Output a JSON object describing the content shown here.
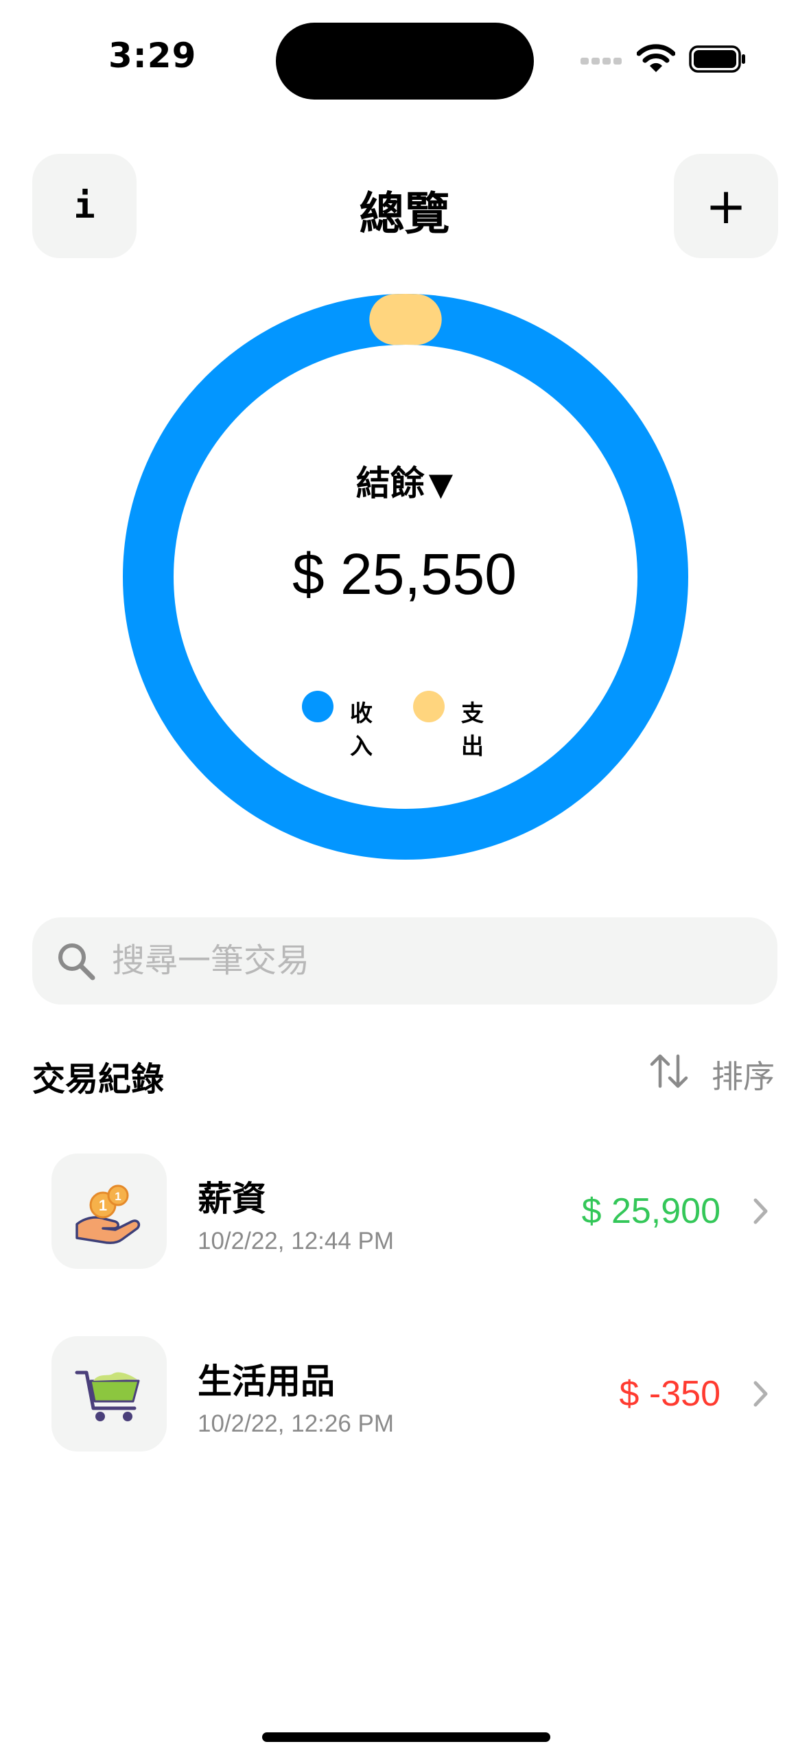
{
  "status_bar": {
    "time": "3:29"
  },
  "header": {
    "title": "總覽",
    "info_label": "i",
    "add_label": "+"
  },
  "summary": {
    "label": "結餘",
    "caret": "▼",
    "balance": "$ 25,550",
    "income_total": 25900,
    "expense_total": 350,
    "legend": [
      {
        "label": "收入",
        "color": "#0396FF"
      },
      {
        "label": "支出",
        "color": "#FFD57E"
      }
    ]
  },
  "search": {
    "placeholder": "搜尋一筆交易",
    "value": ""
  },
  "transactions_section": {
    "title": "交易紀錄",
    "sort_label": "排序"
  },
  "transactions": [
    {
      "title": "薪資",
      "time": "10/2/22, 12:44 PM",
      "amount": "$ 25,900",
      "amount_color": "#34C759",
      "icon": "salary-hand-coins-icon"
    },
    {
      "title": "生活用品",
      "time": "10/2/22, 12:26 PM",
      "amount": "$ -350",
      "amount_color": "#FF3B30",
      "icon": "shopping-cart-icon"
    }
  ],
  "colors": {
    "income": "#0396FF",
    "expense": "#FFD57E",
    "positive": "#34C759",
    "negative": "#FF3B30",
    "muted": "#8A8A8A",
    "tile": "#F3F4F3"
  }
}
